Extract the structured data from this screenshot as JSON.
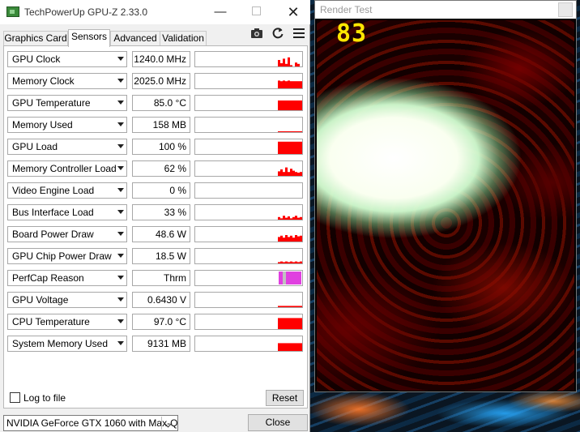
{
  "gpuz": {
    "title": "TechPowerUp GPU-Z 2.33.0",
    "tabs": [
      "Graphics Card",
      "Sensors",
      "Advanced",
      "Validation"
    ],
    "active_tab": "Sensors",
    "sensors": [
      {
        "name": "GPU Clock",
        "value": "1240.0 MHz",
        "graph": [
          0,
          0,
          0,
          0,
          0,
          0,
          0,
          0,
          0,
          0,
          0,
          0,
          0,
          0,
          0,
          0.5,
          0.25,
          0.6,
          0.2,
          0.7,
          0.1,
          0,
          0.3,
          0.2,
          0
        ]
      },
      {
        "name": "Memory Clock",
        "value": "2025.0 MHz",
        "graph": [
          0,
          0,
          0,
          0,
          0,
          0,
          0,
          0,
          0,
          0,
          0,
          0,
          0,
          0,
          0,
          0.6,
          0.55,
          0.6,
          0.55,
          0.6,
          0.55,
          0.55,
          0.55,
          0.55,
          0.55
        ]
      },
      {
        "name": "GPU Temperature",
        "value": "85.0 °C",
        "graph": [
          0,
          0,
          0,
          0,
          0,
          0,
          0,
          0,
          0,
          0,
          0,
          0,
          0,
          0,
          0,
          0.75,
          0.75,
          0.75,
          0.75,
          0.75,
          0.75,
          0.75,
          0.75,
          0.75,
          0.75
        ]
      },
      {
        "name": "Memory Used",
        "value": "158 MB",
        "graph": [
          0,
          0,
          0,
          0,
          0,
          0,
          0,
          0,
          0,
          0,
          0,
          0,
          0,
          0,
          0,
          0.03,
          0.03,
          0.03,
          0.03,
          0.03,
          0.03,
          0.03,
          0.03,
          0.03,
          0.03
        ]
      },
      {
        "name": "GPU Load",
        "value": "100 %",
        "graph": [
          0,
          0,
          0,
          0,
          0,
          0,
          0,
          0,
          0,
          0,
          0,
          0,
          0,
          0,
          0,
          0.95,
          0.95,
          0.95,
          0.95,
          0.95,
          0.95,
          0.95,
          0.95,
          0.95,
          0.95
        ]
      },
      {
        "name": "Memory Controller Load",
        "value": "62 %",
        "graph": [
          0,
          0,
          0,
          0,
          0,
          0,
          0,
          0,
          0,
          0,
          0,
          0,
          0,
          0,
          0,
          0.35,
          0.5,
          0.3,
          0.65,
          0.3,
          0.55,
          0.4,
          0.3,
          0.25,
          0.3
        ]
      },
      {
        "name": "Video Engine Load",
        "value": "0 %",
        "graph": [
          0,
          0,
          0,
          0,
          0,
          0,
          0,
          0,
          0,
          0,
          0,
          0,
          0,
          0,
          0,
          0,
          0,
          0,
          0,
          0,
          0,
          0,
          0,
          0,
          0
        ]
      },
      {
        "name": "Bus Interface Load",
        "value": "33 %",
        "graph": [
          0,
          0,
          0,
          0,
          0,
          0,
          0,
          0,
          0,
          0,
          0,
          0,
          0,
          0,
          0,
          0.2,
          0.1,
          0.3,
          0.15,
          0.25,
          0.1,
          0.2,
          0.3,
          0.15,
          0.2
        ]
      },
      {
        "name": "Board Power Draw",
        "value": "48.6 W",
        "graph": [
          0,
          0,
          0,
          0,
          0,
          0,
          0,
          0,
          0,
          0,
          0,
          0,
          0,
          0,
          0,
          0.35,
          0.45,
          0.3,
          0.5,
          0.35,
          0.45,
          0.3,
          0.5,
          0.4,
          0.45
        ]
      },
      {
        "name": "GPU Chip Power Draw",
        "value": "18.5 W",
        "graph": [
          0,
          0,
          0,
          0,
          0,
          0,
          0,
          0,
          0,
          0,
          0,
          0,
          0,
          0,
          0,
          0.1,
          0.15,
          0.1,
          0.15,
          0.1,
          0.15,
          0.1,
          0.15,
          0.1,
          0.15
        ]
      },
      {
        "name": "PerfCap Reason",
        "value": "Thrm",
        "graph": [
          0,
          0,
          0,
          0,
          0,
          0,
          0,
          0,
          0,
          0,
          0,
          0,
          0,
          0,
          0,
          0,
          0,
          0,
          0,
          0,
          0,
          0,
          0,
          0,
          0
        ]
      },
      {
        "name": "GPU Voltage",
        "value": "0.6430 V",
        "graph": [
          0,
          0,
          0,
          0,
          0,
          0,
          0,
          0,
          0,
          0,
          0,
          0,
          0,
          0,
          0,
          0.1,
          0.1,
          0.1,
          0.1,
          0.1,
          0.1,
          0.1,
          0.1,
          0.1,
          0.1
        ]
      },
      {
        "name": "CPU Temperature",
        "value": "97.0 °C",
        "graph": [
          0,
          0,
          0,
          0,
          0,
          0,
          0,
          0,
          0,
          0,
          0,
          0,
          0,
          0,
          0,
          0.85,
          0.85,
          0.85,
          0.85,
          0.85,
          0.85,
          0.85,
          0.85,
          0.85,
          0.85
        ]
      },
      {
        "name": "System Memory Used",
        "value": "9131 MB",
        "graph": [
          0,
          0,
          0,
          0,
          0,
          0,
          0,
          0,
          0,
          0,
          0,
          0,
          0,
          0,
          0,
          0.6,
          0.6,
          0.6,
          0.6,
          0.6,
          0.6,
          0.6,
          0.6,
          0.6,
          0.6
        ]
      }
    ],
    "log_to_file": {
      "label": "Log to file",
      "checked": false
    },
    "reset_label": "Reset",
    "gpu_select": "NVIDIA GeForce GTX 1060 with Max-Q",
    "close_label": "Close",
    "colors": {
      "graph": "#ff0000",
      "perfcap": "#e040e0",
      "perfcap_light": "#c0c0c0"
    }
  },
  "render_test": {
    "title": "Render Test",
    "fps": "83"
  },
  "icons": [
    "app-icon",
    "camera-icon",
    "refresh-icon",
    "menu-icon",
    "chevron-down-icon",
    "close-icon"
  ]
}
